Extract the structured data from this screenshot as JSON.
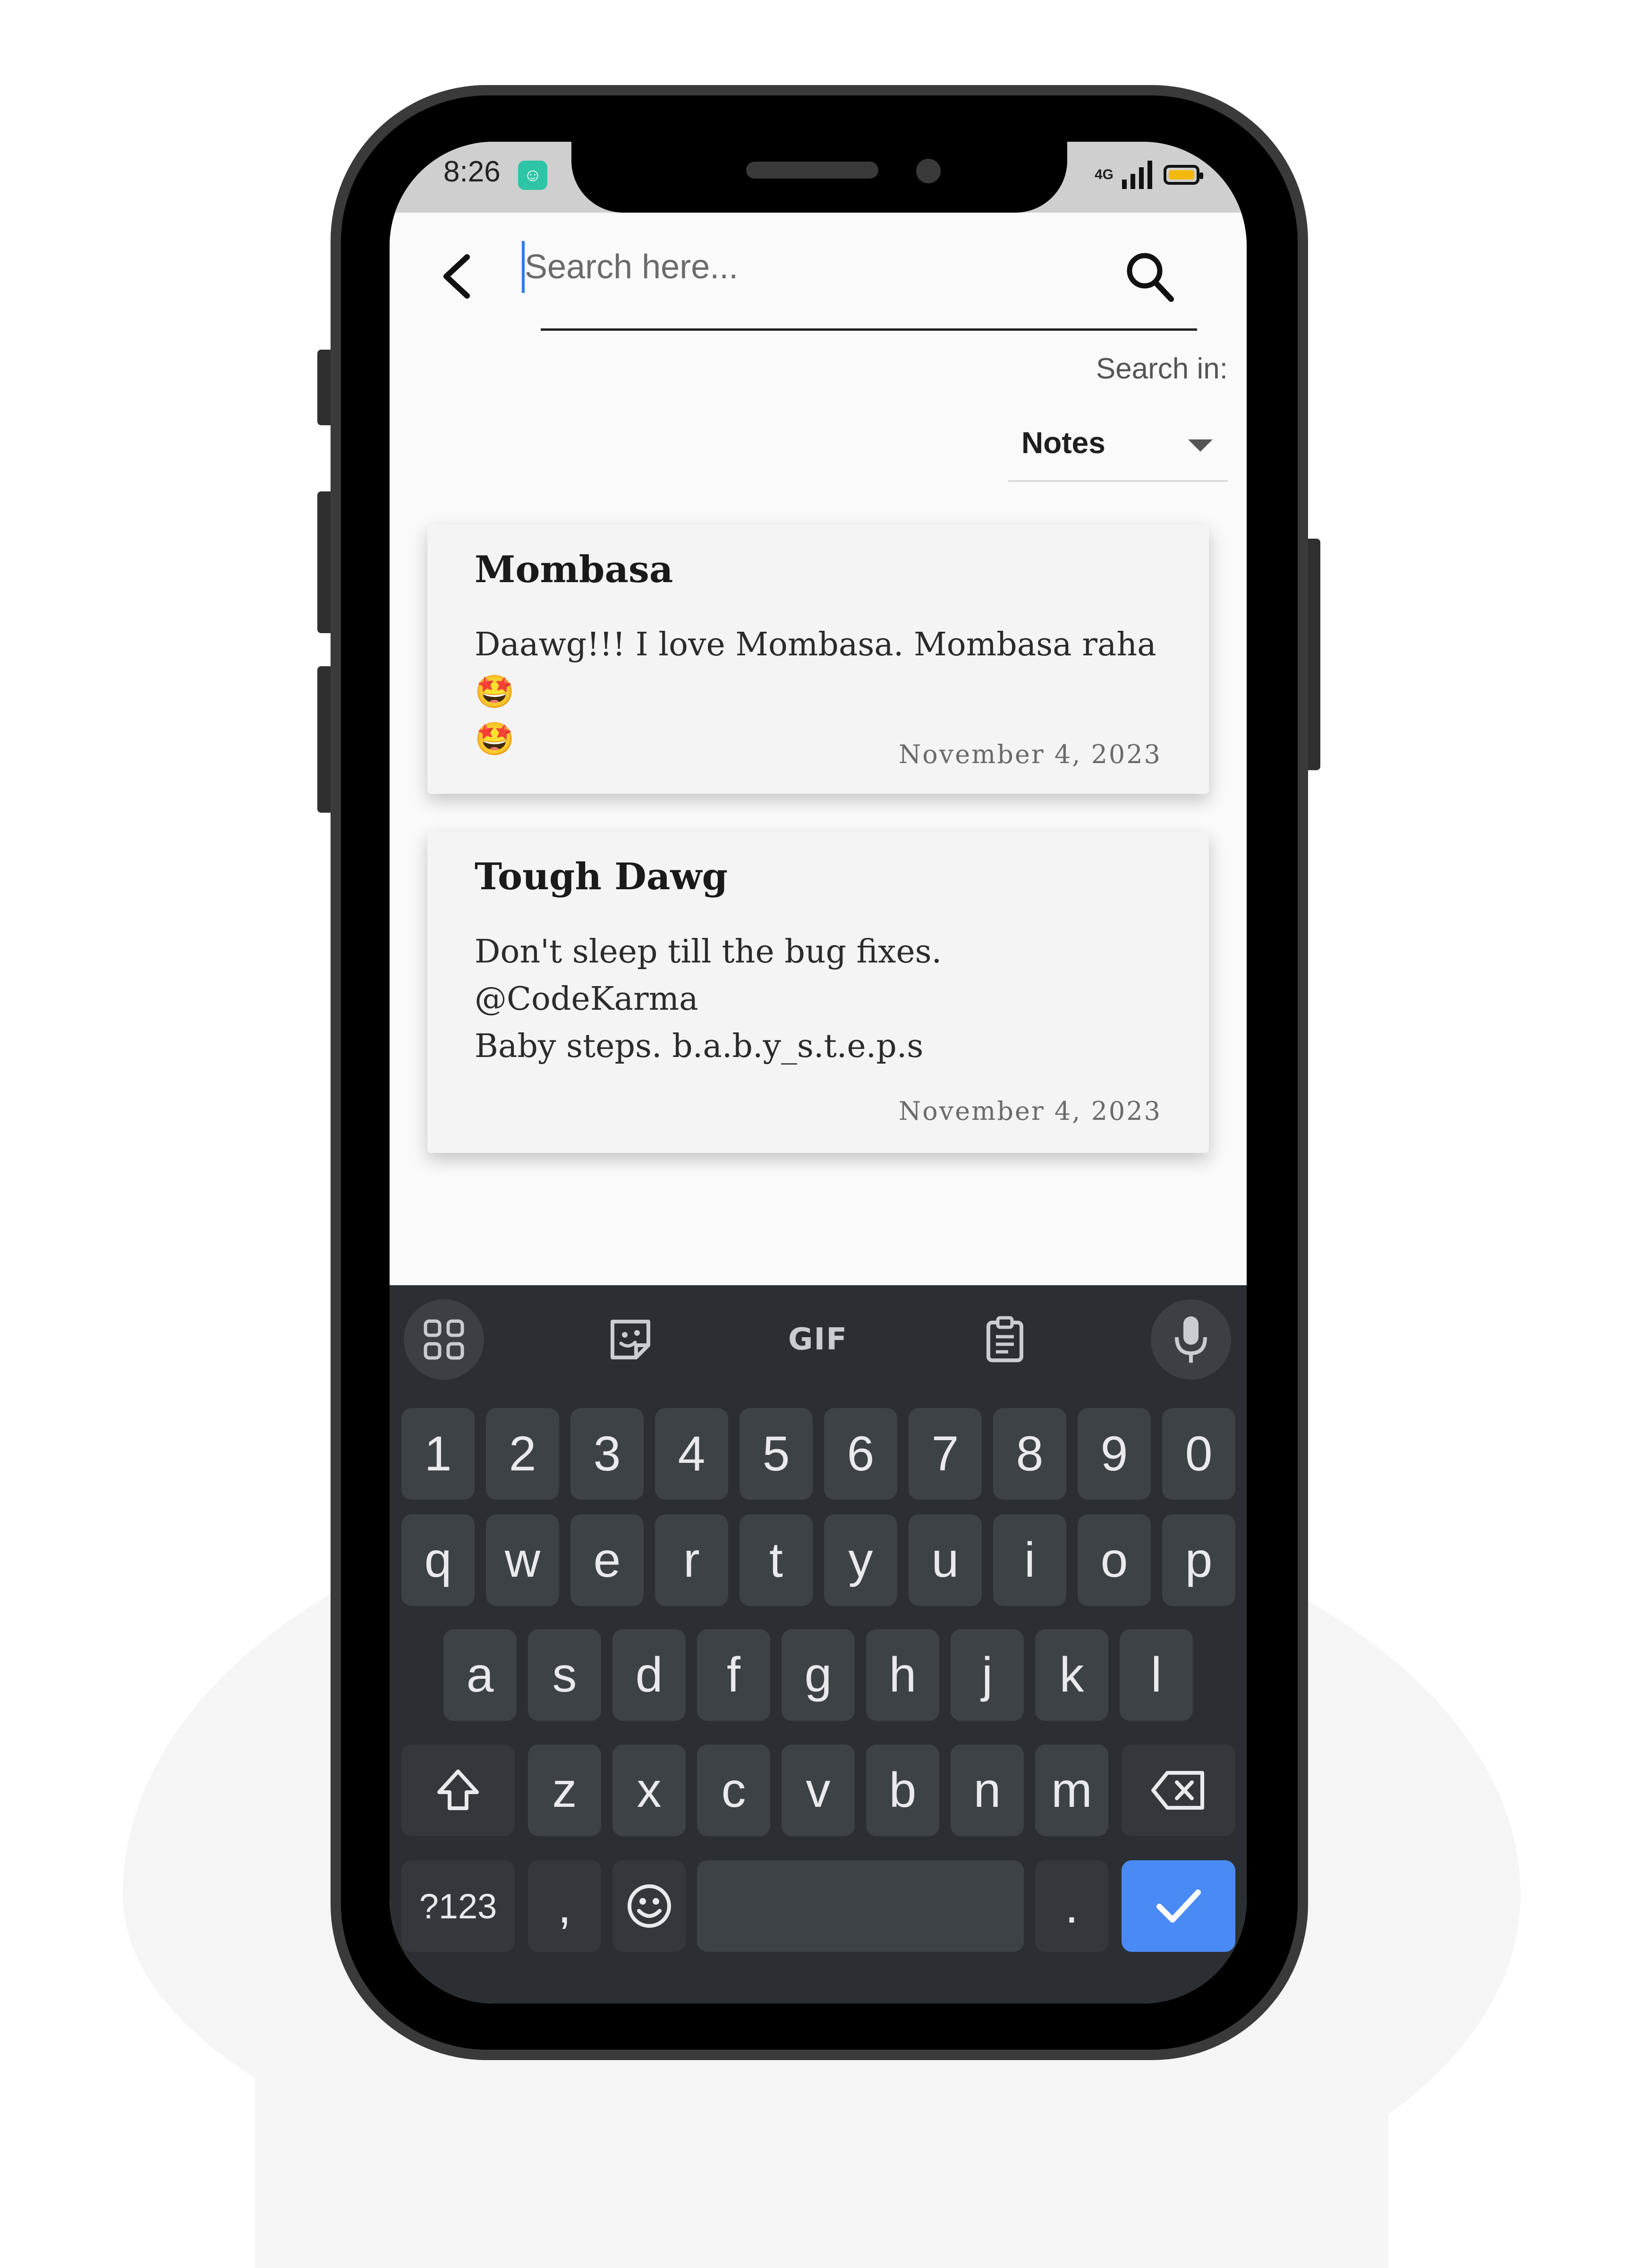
{
  "status_bar": {
    "time": "8:26",
    "network": "4G",
    "app_icon": "notification-app-icon",
    "battery_color": "#f2b90c"
  },
  "search": {
    "placeholder": "Search here...",
    "value": "",
    "search_in_label": "Search in:",
    "scope_selected": "Notes"
  },
  "notes": [
    {
      "title": "Mombasa",
      "body": "Daawg!!! I love Mombasa. Mombasa raha🤩\n🤩",
      "date": "November 4, 2023"
    },
    {
      "title": "Tough Dawg",
      "body": "Don't sleep till the bug fixes.\n@CodeKarma\nBaby steps. b.a.b.y_s.t.e.p.s",
      "date": "November 4, 2023"
    }
  ],
  "keyboard": {
    "toolbar": {
      "gif_label": "GIF",
      "icons": [
        "apps-grid-icon",
        "sticker-icon",
        "gif-icon",
        "clipboard-icon",
        "microphone-icon"
      ]
    },
    "row_numbers": [
      "1",
      "2",
      "3",
      "4",
      "5",
      "6",
      "7",
      "8",
      "9",
      "0"
    ],
    "row_1": [
      "q",
      "w",
      "e",
      "r",
      "t",
      "y",
      "u",
      "i",
      "o",
      "p"
    ],
    "row_2": [
      "a",
      "s",
      "d",
      "f",
      "g",
      "h",
      "j",
      "k",
      "l"
    ],
    "row_3": [
      "z",
      "x",
      "c",
      "v",
      "b",
      "n",
      "m"
    ],
    "bottom": {
      "symbols_label": "?123",
      "comma_label": ",",
      "period_label": "."
    },
    "enter_color": "#4a8af4"
  }
}
